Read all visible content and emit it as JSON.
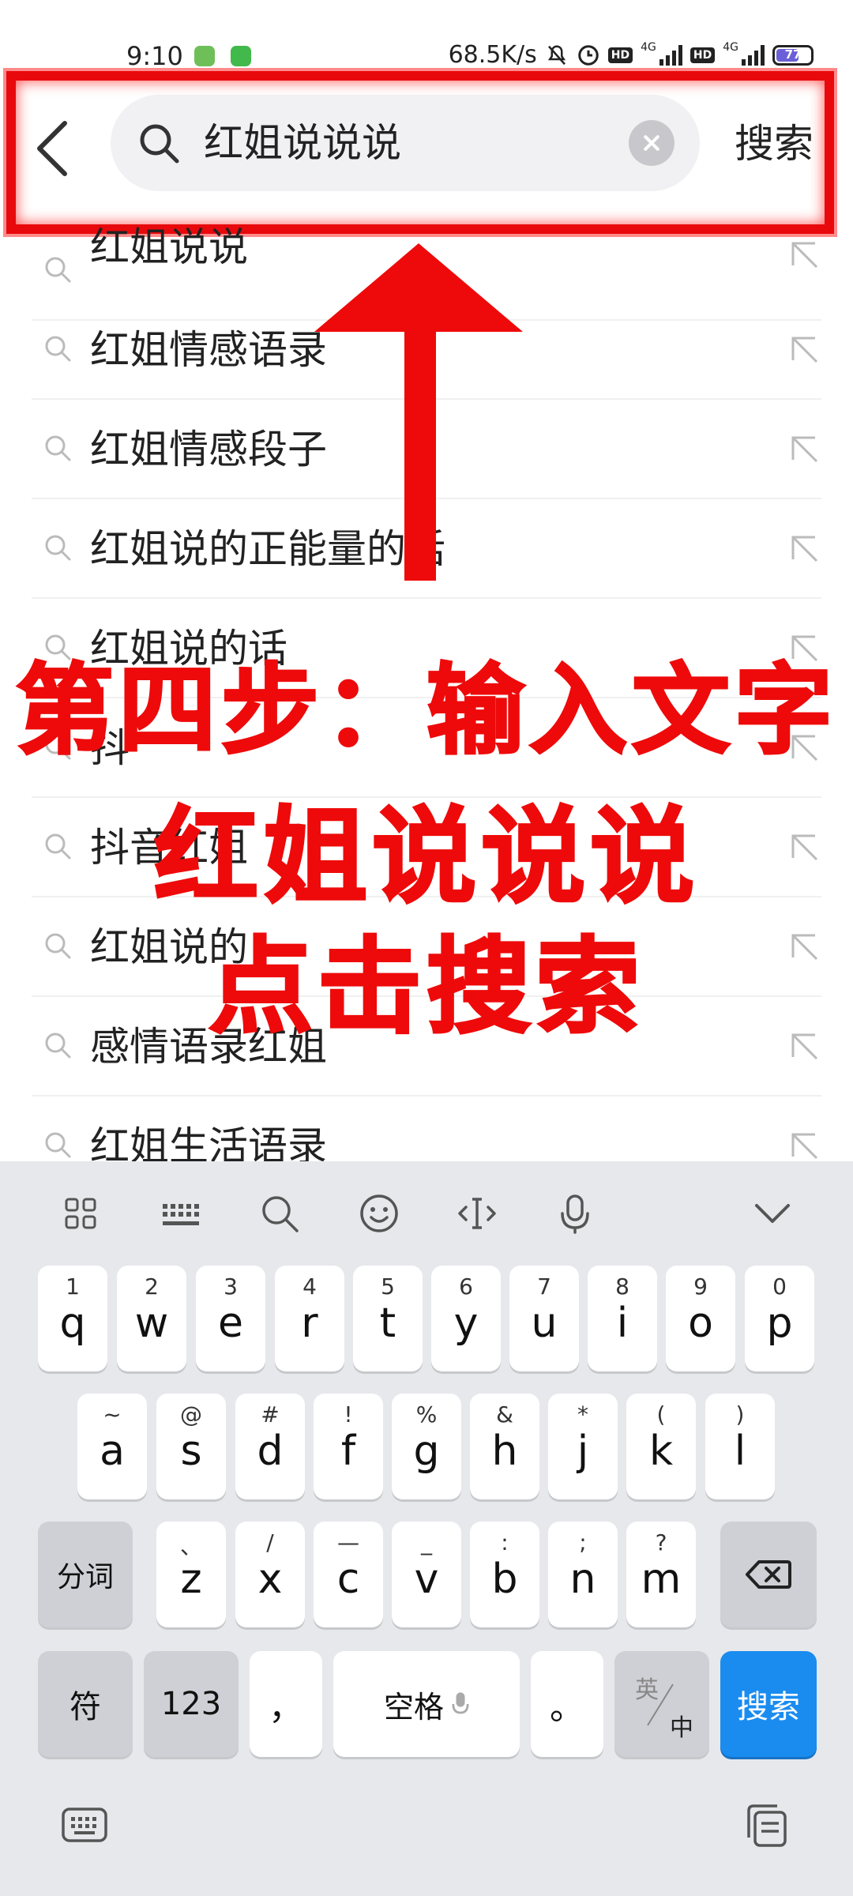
{
  "status_bar": {
    "time": "9:10",
    "network_speed": "68.5K/s",
    "hd_label": "HD",
    "network_type": "4G",
    "battery": "77"
  },
  "search": {
    "back_icon": "chevron-left-icon",
    "query": "红姐说说说",
    "search_label": "搜索"
  },
  "suggestions": [
    "红姐说说",
    "红姐情感语录",
    "红姐情感段子",
    "红姐说的正能量的话",
    "红姐说的话",
    "抖",
    "抖音红姐",
    "红姐说的",
    "感情语录红姐",
    "红姐生活语录"
  ],
  "overlay": {
    "line1": "第四步：输入文字",
    "line2": "红姐说说说",
    "line3": "点击搜索",
    "color": "#ee0a0a"
  },
  "keyboard": {
    "row1": [
      {
        "num": "1",
        "key": "q"
      },
      {
        "num": "2",
        "key": "w"
      },
      {
        "num": "3",
        "key": "e"
      },
      {
        "num": "4",
        "key": "r"
      },
      {
        "num": "5",
        "key": "t"
      },
      {
        "num": "6",
        "key": "y"
      },
      {
        "num": "7",
        "key": "u"
      },
      {
        "num": "8",
        "key": "i"
      },
      {
        "num": "9",
        "key": "o"
      },
      {
        "num": "0",
        "key": "p"
      }
    ],
    "row2": [
      {
        "sym": "~",
        "key": "a"
      },
      {
        "sym": "@",
        "key": "s"
      },
      {
        "sym": "#",
        "key": "d"
      },
      {
        "sym": "!",
        "key": "f"
      },
      {
        "sym": "%",
        "key": "g"
      },
      {
        "sym": "&",
        "key": "h"
      },
      {
        "sym": "*",
        "key": "j"
      },
      {
        "sym": "(",
        "key": "k"
      },
      {
        "sym": ")",
        "key": "l"
      }
    ],
    "row3": [
      {
        "sym": "、",
        "key": "z"
      },
      {
        "sym": "/",
        "key": "x"
      },
      {
        "sym": "—",
        "key": "c"
      },
      {
        "sym": "_",
        "key": "v"
      },
      {
        "sym": ":",
        "key": "b"
      },
      {
        "sym": ";",
        "key": "n"
      },
      {
        "sym": "?",
        "key": "m"
      }
    ],
    "fenci": "分词",
    "fu": "符",
    "num123": "123",
    "comma": "，",
    "space": "空格",
    "period": "。",
    "lang_en": "英",
    "lang_zh": "中",
    "search": "搜索",
    "accent_color": "#1a8cf0"
  }
}
